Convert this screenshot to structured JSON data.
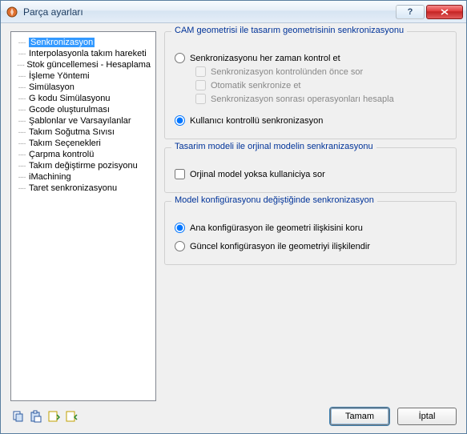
{
  "window": {
    "title": "Parça ayarları"
  },
  "tree": {
    "items": [
      "Senkronizasyon",
      "Interpolasyonla takım hareketi",
      "Stok güncellemesi - Hesaplama",
      "İşleme Yöntemi",
      "Simülasyon",
      "G kodu Simülasyonu",
      "Gcode oluşturulması",
      "Şablonlar ve Varsayılanlar",
      "Takım Soğutma Sıvısı",
      "Takım Seçenekleri",
      "Çarpma kontrolü",
      "Takım değiştirme pozisyonu",
      "iMachining",
      "Taret senkronizasyonu"
    ],
    "selected_index": 0
  },
  "group1": {
    "title": "CAM geometrisi ile tasarım geometrisinin senkronizasyonu",
    "radio1": "Senkronizasyonu her zaman kontrol et",
    "check1": "Senkronizasyon kontrolünden önce sor",
    "check2": "Otomatik senkronize et",
    "check3": "Senkronizasyon sonrası operasyonları hesapla",
    "radio2": "Kullanıcı kontrollü senkronizasyon"
  },
  "group2": {
    "title": "Tasarim modeli ile orjinal modelin senkranizasyonu",
    "check1": "Orjinal model yoksa kullaniciya sor"
  },
  "group3": {
    "title": "Model konfigürasyonu değiştiğinde senkronizasyon",
    "radio1": "Ana konfigürasyon ile geometri ilişkisini koru",
    "radio2": "Güncel konfigürasyon ile geometriyi ilişkilendir"
  },
  "buttons": {
    "ok": "Tamam",
    "cancel": "İptal"
  }
}
